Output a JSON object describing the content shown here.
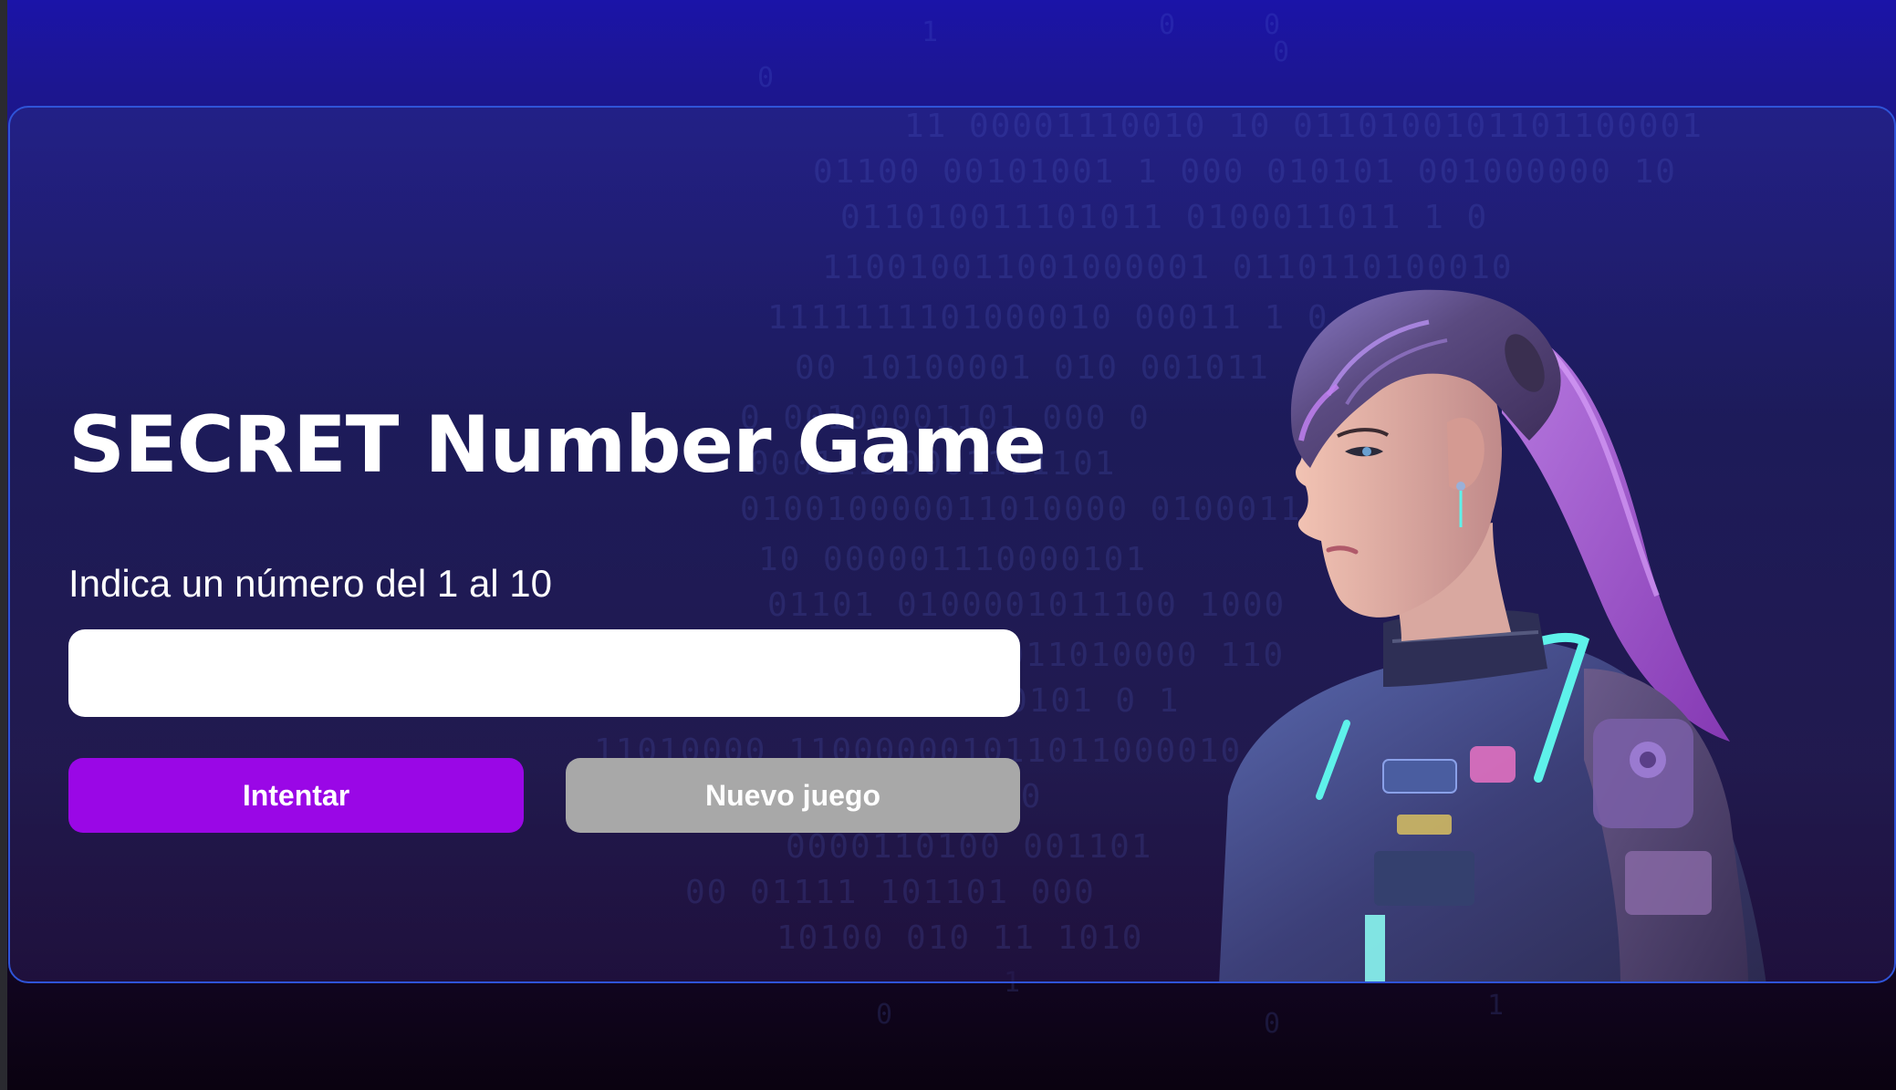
{
  "game": {
    "title": "SECRET Number Game",
    "prompt_label": "Indica un número del 1 al 10",
    "input_value": "",
    "try_button": "Intentar",
    "new_game_button": "Nuevo juego"
  },
  "colors": {
    "primary_button": "#9a07e6",
    "secondary_button": "#a8a8a8",
    "container_border": "#2f54d8",
    "background_top": "#1b14a8",
    "background_bottom": "#0a0210"
  }
}
